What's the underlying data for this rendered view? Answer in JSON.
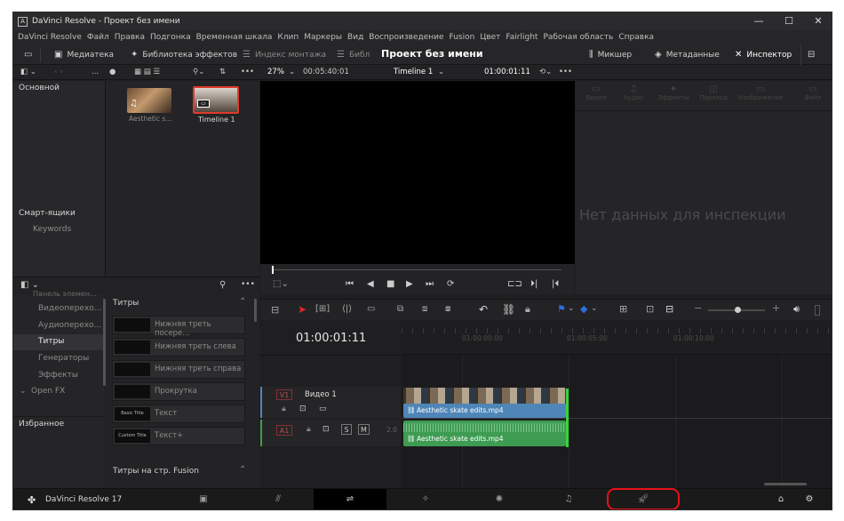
{
  "window": {
    "title": "DaVinci Resolve - Проект без имени",
    "controls": [
      "—",
      "☐",
      "✕"
    ]
  },
  "menu": [
    "DaVinci Resolve",
    "Файл",
    "Правка",
    "Подгонка",
    "Временная шкала",
    "Клип",
    "Маркеры",
    "Вид",
    "Воспроизведение",
    "Fusion",
    "Цвет",
    "Fairlight",
    "Рабочая область",
    "Справка"
  ],
  "toolbar": {
    "media": "Медиатека",
    "effects": "Библиотека эффектов",
    "edit_index": "Индекс монтажа",
    "library_short": "Библ",
    "project_name": "Проект без имени",
    "mixer": "Микшер",
    "metadata": "Метаданные",
    "inspector": "Инспектор"
  },
  "viewer": {
    "zoom": "27%",
    "source_tc": "00:05:40:01",
    "timeline_name": "Timeline 1",
    "record_tc": "01:00:01:11"
  },
  "media_pool": {
    "folder": "Основной",
    "clips": [
      "Aesthetic s...",
      "Timeline 1"
    ],
    "smart_bins_header": "Смарт-ящики",
    "smart_bins": [
      "Keywords"
    ]
  },
  "effects": {
    "toolbox_header": "Панель элемен...",
    "categories": [
      "Видеоперехо...",
      "Аудиоперехо...",
      "Титры",
      "Генераторы",
      "Эффекты",
      "Open FX"
    ],
    "favorites": "Избранное",
    "section": "Титры",
    "items": [
      {
        "name": "Нижняя треть посере...",
        "swatch": ""
      },
      {
        "name": "Нижняя треть слева",
        "swatch": ""
      },
      {
        "name": "Нижняя треть справа",
        "swatch": ""
      },
      {
        "name": "Прокрутка",
        "swatch": ""
      },
      {
        "name": "Текст",
        "swatch": "Basic Title"
      },
      {
        "name": "Текст+",
        "swatch": "Custom Title"
      }
    ],
    "fusion_section": "Титры на стр. Fusion"
  },
  "inspector": {
    "tabs": [
      "Видео",
      "Аудио",
      "Эффекты",
      "Переход",
      "Изображение",
      "Файл"
    ],
    "empty_message": "Нет данных для инспекции"
  },
  "timeline": {
    "timecode": "01:00:01:11",
    "ruler": [
      "01:00:00:00",
      "01:00:05:00",
      "01:00:10:00"
    ],
    "video_track": {
      "id": "V1",
      "name": "Видео 1"
    },
    "audio_track": {
      "id": "A1",
      "level": "2.0",
      "solo": "S",
      "mute": "M"
    },
    "video_clip": "Aesthetic skate edits.mp4",
    "audio_clip": "Aesthetic skate edits.mp4"
  },
  "footer": {
    "app": "DaVinci Resolve 17"
  },
  "colors": {
    "accent_red": "#e8101a",
    "video_clip": "#4f86b8",
    "audio_clip": "#3e9c52",
    "playhead": "#36d43a",
    "flag_blue": "#2f6fe0"
  }
}
